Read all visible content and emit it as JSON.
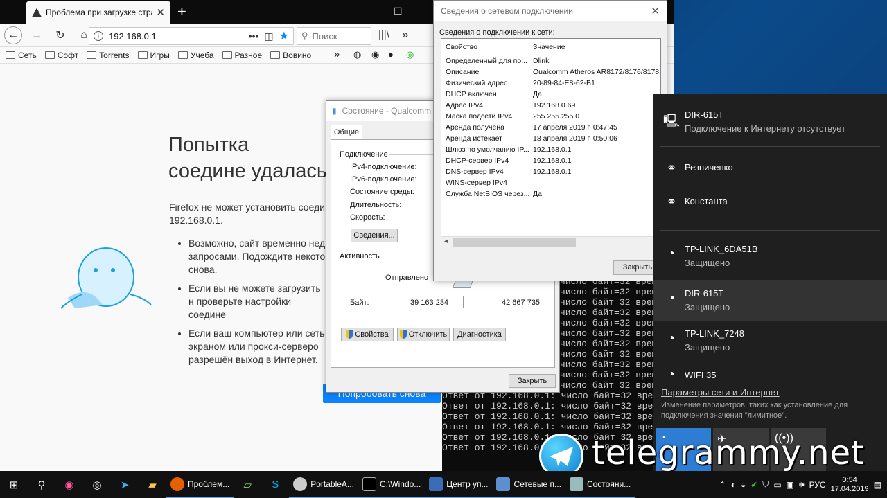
{
  "firefox": {
    "tab_title": "Проблема при загрузке стра",
    "url": "192.168.0.1",
    "search_placeholder": "Поиск",
    "bookmarks": [
      "Сеть",
      "Софт",
      "Torrents",
      "Игры",
      "Учеба",
      "Разное",
      "Вовино"
    ],
    "error_title": "Попытка соедине удалась",
    "error_desc": "Firefox не может установить соеди 192.168.0.1.",
    "bullets": [
      "Возможно, сайт временно нед запросами. Подождите некото снова.",
      "Если вы не можете загрузить н проверьте настройки соедине",
      "Если ваш компьютер или сеть экраном или прокси-серверо разрешён выход в Интернет."
    ],
    "retry_button": "Попробовать снова"
  },
  "cmd": {
    "lines": [
      "число байт=32 врем",
      "число байт=32 врем",
      "число байт=32 врем",
      "число байт=32 врем",
      "число байт=32 врем",
      "число байт=32 врем",
      "число байт=32 врем",
      "число байт=32 врем",
      "число байт=32 врем",
      "число байт=32 врем",
      "число байт=32 врем",
      "Ответ от 192.168.0.1: число байт=32 врем",
      "Ответ от 192.168.0.1: число байт=32 врем",
      "Ответ от 192.168.0.1: число байт=32 врем",
      "Ответ от 192.168.0.1: число байт=32 врем",
      "Ответ от 192.168.0.1: число байт=32 врем",
      "Ответ от 192.168.0.1: число байт=32 врем"
    ]
  },
  "status_window": {
    "title": "Состояние - Qualcomm A",
    "tab": "Общие",
    "section_connection": "Подключение",
    "labels": [
      "IPv4-подключение:",
      "IPv6-подключение:",
      "Состояние среды:",
      "Длительность:",
      "Скорость:"
    ],
    "details_button": "Сведения...",
    "section_activity": "Активность",
    "sent_label": "Отправлено",
    "bytes_label": "Байт:",
    "bytes_sent": "39 163 234",
    "bytes_received": "42 667 735",
    "properties_button": "Свойства",
    "disable_button": "Отключить",
    "diagnose_button": "Диагностика",
    "close_button": "Закрыть"
  },
  "details_window": {
    "title": "Сведения о сетевом подключении",
    "caption": "Сведения о подключении к сети:",
    "col_property": "Свойство",
    "col_value": "Значение",
    "rows": [
      {
        "k": "Определенный для по...",
        "v": "Dlink"
      },
      {
        "k": "Описание",
        "v": "Qualcomm Atheros AR8172/8176/8178 F"
      },
      {
        "k": "Физический адрес",
        "v": "20-89-84-E8-62-B1"
      },
      {
        "k": "DHCP включен",
        "v": "Да"
      },
      {
        "k": "Адрес IPv4",
        "v": "192.168.0.69"
      },
      {
        "k": "Маска подсети IPv4",
        "v": "255.255.255.0"
      },
      {
        "k": "Аренда получена",
        "v": "17 апреля 2019 г. 0:47:45"
      },
      {
        "k": "Аренда истекает",
        "v": "18 апреля 2019 г. 0:50:06"
      },
      {
        "k": "Шлюз по умолчанию IP...",
        "v": "192.168.0.1"
      },
      {
        "k": "DHCP-сервер IPv4",
        "v": "192.168.0.1"
      },
      {
        "k": "DNS-сервер IPv4",
        "v": "192.168.0.1"
      },
      {
        "k": "WINS-сервер IPv4",
        "v": ""
      },
      {
        "k": "Служба NetBIOS через...",
        "v": "Да"
      }
    ],
    "close_button": "Закрыть"
  },
  "wifi": {
    "connected_name": "DIR-615T",
    "connected_status": "Подключение к Интернету отсутствует",
    "networks": [
      {
        "name": "Резниченко",
        "status": ""
      },
      {
        "name": "Константа",
        "status": ""
      },
      {
        "name": "TP-LINK_6DA51B",
        "status": "Защищено"
      },
      {
        "name": "DIR-615T",
        "status": "Защищено"
      },
      {
        "name": "TP-LINK_7248",
        "status": "Защищено"
      },
      {
        "name": "WIFI 35",
        "status": ""
      }
    ],
    "settings_link": "Параметры сети и Интернет",
    "settings_sub": "Изменение параметров, таких как установление для подключения значения \"лимитное\"."
  },
  "taskbar": {
    "apps": [
      "Проблем...",
      "PortableA...",
      "C:\\Windo...",
      "Центр уп...",
      "Сетевые п...",
      "Состояни..."
    ],
    "lang": "РУС",
    "time": "0:54",
    "date": "17.04.2019"
  },
  "watermark": "telegrammy.net"
}
